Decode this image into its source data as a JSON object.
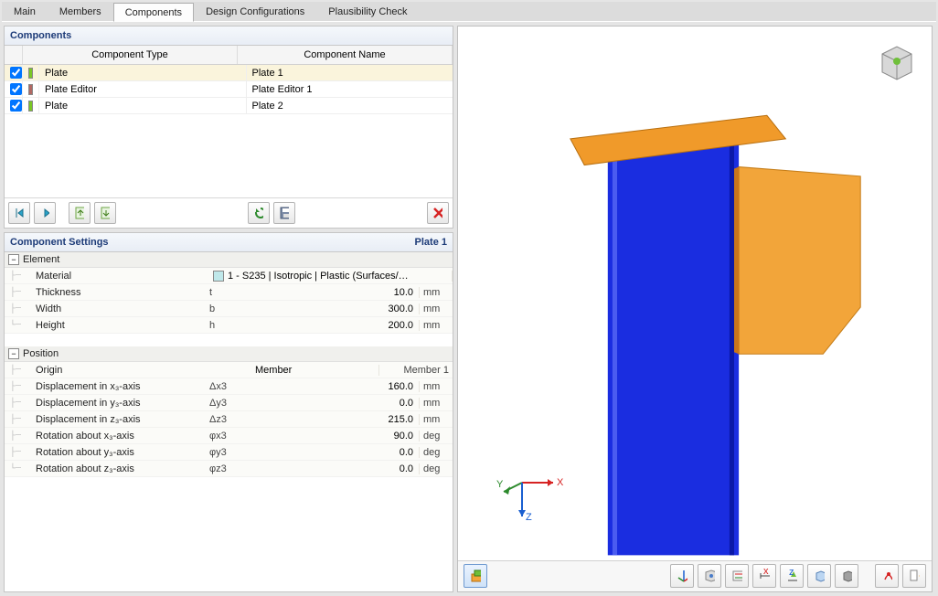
{
  "tabs": [
    "Main",
    "Members",
    "Components",
    "Design Configurations",
    "Plausibility Check"
  ],
  "active_tab": 2,
  "components_panel": {
    "title": "Components",
    "headers": {
      "type": "Component Type",
      "name": "Component Name"
    },
    "rows": [
      {
        "checked": true,
        "color": "#7ac625",
        "type": "Plate",
        "name": "Plate 1",
        "selected": true
      },
      {
        "checked": true,
        "color": "#b06862",
        "type": "Plate Editor",
        "name": "Plate Editor 1",
        "selected": false
      },
      {
        "checked": true,
        "color": "#7ac625",
        "type": "Plate",
        "name": "Plate 2",
        "selected": false
      }
    ]
  },
  "settings_panel": {
    "title": "Component Settings",
    "context": "Plate 1",
    "sections": [
      {
        "label": "Element",
        "rows": [
          {
            "label": "Material",
            "sym": "",
            "value_full": "1 - S235 | Isotropic | Plastic (Surfaces/…",
            "unit": ""
          },
          {
            "label": "Thickness",
            "sym": "t",
            "value": "10.0",
            "unit": "mm"
          },
          {
            "label": "Width",
            "sym": "b",
            "value": "300.0",
            "unit": "mm"
          },
          {
            "label": "Height",
            "sym": "h",
            "value": "200.0",
            "unit": "mm"
          }
        ]
      },
      {
        "label": "Position",
        "rows": [
          {
            "label": "Origin",
            "sym": "",
            "value_split": {
              "left": "Member",
              "right": "Member 1"
            },
            "unit": ""
          },
          {
            "label": "Displacement in x₃-axis",
            "sym": "Δx3",
            "value": "160.0",
            "unit": "mm"
          },
          {
            "label": "Displacement in y₃-axis",
            "sym": "Δy3",
            "value": "0.0",
            "unit": "mm"
          },
          {
            "label": "Displacement in z₃-axis",
            "sym": "Δz3",
            "value": "215.0",
            "unit": "mm"
          },
          {
            "label": "Rotation about x₃-axis",
            "sym": "φx3",
            "value": "90.0",
            "unit": "deg"
          },
          {
            "label": "Rotation about y₃-axis",
            "sym": "φy3",
            "value": "0.0",
            "unit": "deg"
          },
          {
            "label": "Rotation about z₃-axis",
            "sym": "φz3",
            "value": "0.0",
            "unit": "deg"
          }
        ]
      }
    ]
  },
  "toolbar_icons": {
    "add_left": "add-left-icon",
    "add_right": "add-right-icon",
    "copy_left": "copy-left-icon",
    "copy_right": "copy-right-icon",
    "refresh": "refresh-icon",
    "save": "save-icon",
    "delete": "delete-icon"
  },
  "viewport_axis": {
    "x": "X",
    "y": "Y",
    "z": "Z"
  },
  "viewport_toolbar": [
    {
      "name": "view-mode-button",
      "active": true
    },
    {
      "name": "axes-toggle-button"
    },
    {
      "name": "view-direction-button"
    },
    {
      "name": "show-labels-button"
    },
    {
      "name": "show-dimensions-button"
    },
    {
      "name": "isolate-button"
    },
    {
      "name": "transparency-button"
    },
    {
      "name": "render-mode-button"
    },
    {
      "name": "deformation-button"
    },
    {
      "name": "snapshot-button"
    }
  ]
}
